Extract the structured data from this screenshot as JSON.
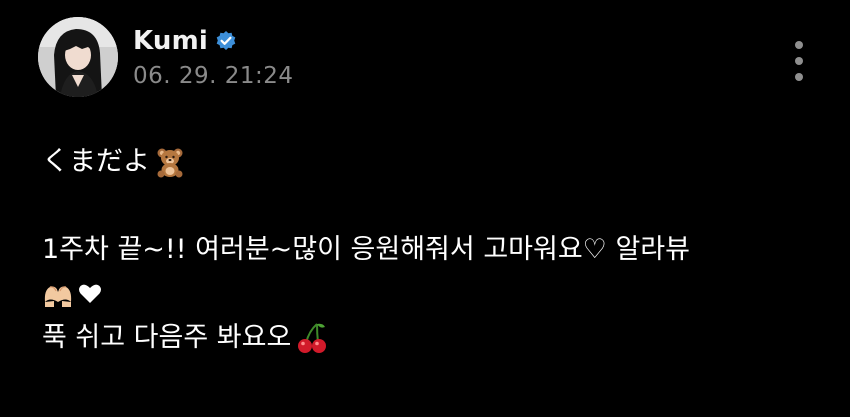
{
  "post": {
    "author": {
      "name": "Kumi",
      "verified": true
    },
    "timestamp": "06. 29. 21:24",
    "content": {
      "line1": "くまだよ",
      "line1_emoji": "teddy-bear",
      "line2": "1주차 끝~!! 여러분~많이 응원해줘서 고마워요♡ 알라뷰",
      "line3_emojis": [
        "heart-hands",
        "white-heart"
      ],
      "line4": "푹 쉬고 다음주 봐요오",
      "line4_emoji": "cherries"
    }
  },
  "colors": {
    "background": "#000000",
    "name": "#f2f2f2",
    "timestamp": "#8a8a8a",
    "verified_badge": "#3d8fd9",
    "menu_dots": "#8f8f8f"
  },
  "icons": {
    "verified": "verified-badge-icon",
    "more": "more-vertical-icon"
  }
}
